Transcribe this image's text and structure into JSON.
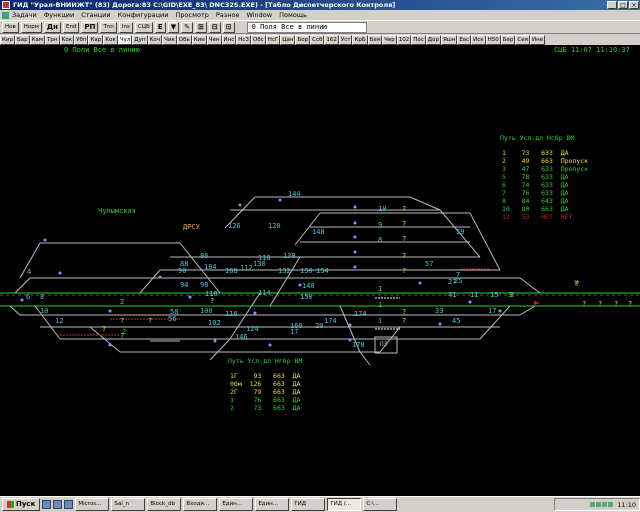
{
  "window": {
    "title": "ГИД \"Урал-ВНИИЖТ\" (83) Дорога:83 C:\\GID\\EXE_83\\ DNC32S.EXE) - [Табло Диспетчерского Контроля]",
    "buttons": [
      "_",
      "□",
      "×"
    ]
  },
  "menu": [
    "Задачи",
    "Функции",
    "Станции",
    "Конфигурации",
    "Просмотр",
    "Разное",
    "Window",
    "Помощь"
  ],
  "toolbar": {
    "buttons": [
      "Нов",
      "Норм",
      "Дн",
      "End",
      "РП",
      "Тnп",
      "Ins",
      "СЦБ",
      "Е",
      "▼",
      "✎",
      "⊞",
      "⊟",
      "⊡"
    ],
    "status_field": "0 Поля Все в линию"
  },
  "stations": [
    "Кир",
    "Бар",
    "Кам",
    "Трн",
    "Кок",
    "Убп",
    "Кар",
    "Кок",
    "Чул",
    "Дуп",
    "Коч",
    "Чик",
    "Обь",
    "Кии",
    "Чен",
    "Инс",
    "НсЗ",
    "Обс",
    "НсГ",
    "Цан",
    "Бор",
    "Ссб",
    "162",
    "Уст",
    "КрБ",
    "Бея",
    "Чер",
    "102",
    "Пос",
    "Дор",
    "Яшн",
    "Евс",
    "Иск",
    "Н50",
    "Бер",
    "Сея",
    "Ине"
  ],
  "active_station": 8,
  "schematic": {
    "header_left": "0 Поли Все в линию",
    "header_right": "СЦБ 11:07 11:10:37",
    "station_name": "Чулымская",
    "station_code": "ДРСУ",
    "pz_label": "ПЗ",
    "signal_marker": "У",
    "track_numbers": [
      {
        "text": "144",
        "c": "#4fc4d0"
      },
      {
        "text": "126",
        "c": "#4fc4d0"
      },
      {
        "text": "120",
        "c": "#4fc4d0"
      },
      {
        "text": "148",
        "c": "#4fc4d0"
      },
      {
        "text": "10",
        "c": "#4fc4d0"
      },
      {
        "text": "9",
        "c": "#4fc4d0"
      },
      {
        "text": "8",
        "c": "#4fc4d0"
      },
      {
        "text": "39",
        "c": "#4fc4d0"
      },
      {
        "text": "4",
        "c": "#4fc4d0"
      },
      {
        "text": "86",
        "c": "#4fc4d0"
      },
      {
        "text": "88",
        "c": "#4fc4d0"
      },
      {
        "text": "90",
        "c": "#4fc4d0"
      },
      {
        "text": "104",
        "c": "#4fc4d0"
      },
      {
        "text": "108",
        "c": "#4fc4d0"
      },
      {
        "text": "112",
        "c": "#4fc4d0"
      },
      {
        "text": "118",
        "c": "#4fc4d0"
      },
      {
        "text": "130",
        "c": "#4fc4d0"
      },
      {
        "text": "138",
        "c": "#4fc4d0"
      },
      {
        "text": "132",
        "c": "#4fc4d0"
      },
      {
        "text": "150",
        "c": "#4fc4d0"
      },
      {
        "text": "154",
        "c": "#4fc4d0"
      },
      {
        "text": "7",
        "c": "#4fc4d0"
      },
      {
        "text": "57",
        "c": "#4fc4d0"
      },
      {
        "text": "25",
        "c": "#4fc4d0"
      },
      {
        "text": "6",
        "c": "#4fc4d0"
      },
      {
        "text": "8",
        "c": "#4fc4d0"
      },
      {
        "text": "94",
        "c": "#4fc4d0"
      },
      {
        "text": "98",
        "c": "#4fc4d0"
      },
      {
        "text": "110",
        "c": "#4fc4d0"
      },
      {
        "text": "114",
        "c": "#4fc4d0"
      },
      {
        "text": "140",
        "c": "#4fc4d0"
      },
      {
        "text": "158",
        "c": "#4fc4d0"
      },
      {
        "text": "1",
        "c": "#4fc4d0"
      },
      {
        "text": "2",
        "c": "#4fc4d0"
      },
      {
        "text": "27",
        "c": "#4fc4d0"
      },
      {
        "text": "41",
        "c": "#4fc4d0"
      },
      {
        "text": "11",
        "c": "#4fc4d0"
      },
      {
        "text": "15",
        "c": "#4fc4d0"
      },
      {
        "text": "17",
        "c": "#4fc4d0"
      },
      {
        "text": "3",
        "c": "#4fc4d0"
      },
      {
        "text": "10",
        "c": "#4fc4d0"
      },
      {
        "text": "12",
        "c": "#4fc4d0"
      },
      {
        "text": "56",
        "c": "#4fc4d0"
      },
      {
        "text": "58",
        "c": "#4fc4d0"
      },
      {
        "text": "100",
        "c": "#4fc4d0"
      },
      {
        "text": "102",
        "c": "#4fc4d0"
      },
      {
        "text": "116",
        "c": "#4fc4d0"
      },
      {
        "text": "174",
        "c": "#4fc4d0"
      },
      {
        "text": "33",
        "c": "#4fc4d0"
      },
      {
        "text": "45",
        "c": "#4fc4d0"
      },
      {
        "text": "17",
        "c": "#4fc4d0"
      },
      {
        "text": "20",
        "c": "#4fc4d0"
      },
      {
        "text": "146",
        "c": "#4fc4d0"
      },
      {
        "text": "160",
        "c": "#4fc4d0"
      },
      {
        "text": "174",
        "c": "#4fc4d0"
      },
      {
        "text": "178",
        "c": "#4fc4d0"
      },
      {
        "text": "124",
        "c": "#4fc4d0"
      },
      {
        "text": "2",
        "c": "#2ed02e"
      },
      {
        "text": "3",
        "c": "#2ed02e"
      },
      {
        "text": "1",
        "c": "#2ed02e"
      },
      {
        "text": "1",
        "c": "#2ed02e"
      }
    ],
    "question_marks": "?",
    "top_info": {
      "header": "Путь Усл.дл Нгбр ВМ",
      "rows": [
        {
          "text": "1    73   633  ДА",
          "c": "#e8e020"
        },
        {
          "text": "2    49   663  Пропуск",
          "c": "#e8e020"
        },
        {
          "text": "3    47   633  Пропуск",
          "c": "#2ed02e"
        },
        {
          "text": "5    78   633  ДА",
          "c": "#2ed02e"
        },
        {
          "text": "6    74   633  ДА",
          "c": "#2ed02e"
        },
        {
          "text": "7    76   633  ДА",
          "c": "#2ed02e"
        },
        {
          "text": "8    84   643  ДА",
          "c": "#2ed02e"
        },
        {
          "text": "10   80   663  ДА",
          "c": "#2ed02e"
        },
        {
          "text": "12   53   НЕТ  НЕТ",
          "c": "#d02020"
        }
      ]
    },
    "bottom_info": {
      "header": "Путь Усл.дл Нгбр ВМ",
      "rows": [
        {
          "text": "1Г    93   663  ДА",
          "c": "#e8e020"
        },
        {
          "text": "0бм  126   663  ДА",
          "c": "#e8e020"
        },
        {
          "text": "2Г    79   663  ДА",
          "c": "#e8e020"
        },
        {
          "text": "1     76   663  ДА",
          "c": "#2ed02e"
        },
        {
          "text": "2     73   663  ДА",
          "c": "#2ed02e"
        }
      ]
    }
  },
  "taskbar": {
    "start": "Пуск",
    "tasks": [
      "Micros...",
      "Sai_n",
      "Block_db",
      "Входя...",
      "Един...",
      "Един...",
      "ГИД",
      "ГИД (...",
      "C:\\..."
    ],
    "active_task": 7,
    "clock": "11:10"
  }
}
